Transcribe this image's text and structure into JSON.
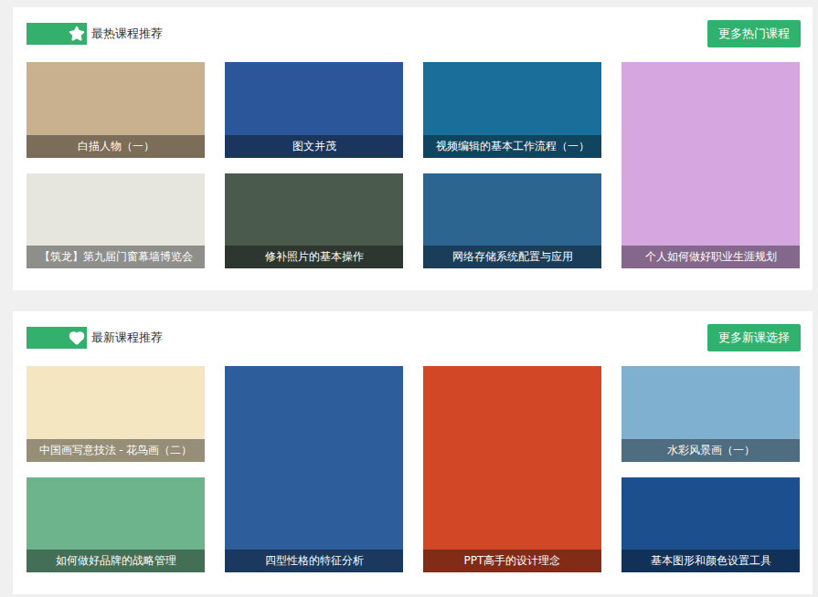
{
  "sections": [
    {
      "title": "最热课程推荐",
      "kind": "hot",
      "more": "更多热门课程",
      "columns": [
        [
          {
            "caption": "白描人物（一）",
            "color": "#c9b08e"
          },
          {
            "caption": "【筑龙】第九届门窗幕墙博览会",
            "color": "#e6e6df"
          }
        ],
        [
          {
            "caption": "图文并茂",
            "color": "#2b579a"
          },
          {
            "caption": "修补照片的基本操作",
            "color": "#4a5a4c"
          }
        ],
        [
          {
            "caption": "视频编辑的基本工作流程（一）",
            "color": "#1a6f9a"
          },
          {
            "caption": "网络存储系统配置与应用",
            "color": "#2b6590"
          }
        ],
        [
          {
            "caption": "个人如何做好职业生涯规划",
            "color": "#d5a6e0"
          }
        ]
      ]
    },
    {
      "title": "最新课程推荐",
      "kind": "new",
      "more": "更多新课选择",
      "columns": [
        [
          {
            "caption": "中国画写意技法 - 花鸟画（二）",
            "color": "#f3e6c0"
          },
          {
            "caption": "如何做好品牌的战略管理",
            "color": "#6db38c"
          }
        ],
        [
          {
            "caption": "四型性格的特征分析",
            "color": "#2d5d9a"
          }
        ],
        [
          {
            "caption": "PPT高手的设计理念",
            "color": "#d24726"
          }
        ],
        [
          {
            "caption": "水彩风景画（一）",
            "color": "#7fb0d0"
          },
          {
            "caption": "基本图形和颜色设置工具",
            "color": "#1c4f8e"
          }
        ]
      ]
    }
  ]
}
